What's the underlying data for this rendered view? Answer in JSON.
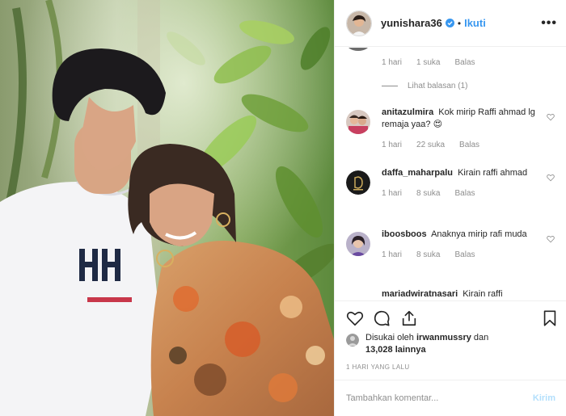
{
  "header": {
    "username": "yunishara36",
    "separator": "•",
    "follow_label": "Ikuti",
    "more_label": "•••",
    "verified_icon": "verified-badge-icon",
    "accent_color": "#3897f0"
  },
  "comments": {
    "first_meta": {
      "time": "1 hari",
      "likes": "1 suka",
      "reply": "Balas"
    },
    "view_replies": "Lihat balasan (1)",
    "items": [
      {
        "user": "anitazulmira",
        "text": "Kok mirip Raffi ahmad lg remaja yaa? 😍",
        "time": "1 hari",
        "likes": "22 suka",
        "reply": "Balas"
      },
      {
        "user": "daffa_maharpalu",
        "text": "Kirain raffi ahmad",
        "time": "1 hari",
        "likes": "8 suka",
        "reply": "Balas"
      },
      {
        "user": "iboosboos",
        "text": "Anaknya mirip rafi muda",
        "time": "1 hari",
        "likes": "8 suka",
        "reply": "Balas"
      },
      {
        "user": "mariadwiratnasari",
        "text": "Kirain raffi"
      }
    ]
  },
  "actions": {
    "likes_prefix": "Disukai oleh ",
    "likes_user": "irwanmussry",
    "likes_suffix": " dan",
    "likes_count": "13,028 lainnya",
    "time_ago": "1 HARI YANG LALU"
  },
  "comment_box": {
    "placeholder": "Tambahkan komentar...",
    "post_label": "Kirim"
  }
}
